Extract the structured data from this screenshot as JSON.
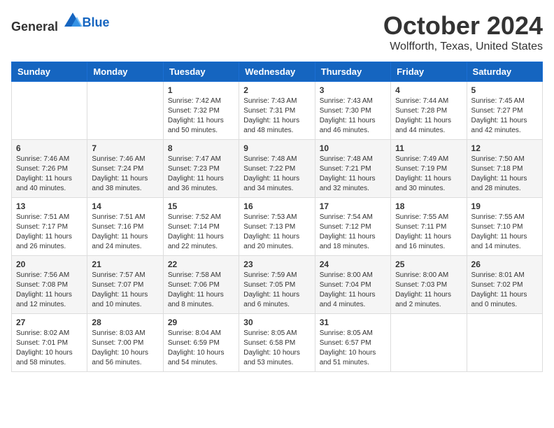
{
  "header": {
    "logo_general": "General",
    "logo_blue": "Blue",
    "month": "October 2024",
    "location": "Wolfforth, Texas, United States"
  },
  "weekdays": [
    "Sunday",
    "Monday",
    "Tuesday",
    "Wednesday",
    "Thursday",
    "Friday",
    "Saturday"
  ],
  "weeks": [
    [
      {
        "day": "",
        "info": ""
      },
      {
        "day": "",
        "info": ""
      },
      {
        "day": "1",
        "info": "Sunrise: 7:42 AM\nSunset: 7:32 PM\nDaylight: 11 hours and 50 minutes."
      },
      {
        "day": "2",
        "info": "Sunrise: 7:43 AM\nSunset: 7:31 PM\nDaylight: 11 hours and 48 minutes."
      },
      {
        "day": "3",
        "info": "Sunrise: 7:43 AM\nSunset: 7:30 PM\nDaylight: 11 hours and 46 minutes."
      },
      {
        "day": "4",
        "info": "Sunrise: 7:44 AM\nSunset: 7:28 PM\nDaylight: 11 hours and 44 minutes."
      },
      {
        "day": "5",
        "info": "Sunrise: 7:45 AM\nSunset: 7:27 PM\nDaylight: 11 hours and 42 minutes."
      }
    ],
    [
      {
        "day": "6",
        "info": "Sunrise: 7:46 AM\nSunset: 7:26 PM\nDaylight: 11 hours and 40 minutes."
      },
      {
        "day": "7",
        "info": "Sunrise: 7:46 AM\nSunset: 7:24 PM\nDaylight: 11 hours and 38 minutes."
      },
      {
        "day": "8",
        "info": "Sunrise: 7:47 AM\nSunset: 7:23 PM\nDaylight: 11 hours and 36 minutes."
      },
      {
        "day": "9",
        "info": "Sunrise: 7:48 AM\nSunset: 7:22 PM\nDaylight: 11 hours and 34 minutes."
      },
      {
        "day": "10",
        "info": "Sunrise: 7:48 AM\nSunset: 7:21 PM\nDaylight: 11 hours and 32 minutes."
      },
      {
        "day": "11",
        "info": "Sunrise: 7:49 AM\nSunset: 7:19 PM\nDaylight: 11 hours and 30 minutes."
      },
      {
        "day": "12",
        "info": "Sunrise: 7:50 AM\nSunset: 7:18 PM\nDaylight: 11 hours and 28 minutes."
      }
    ],
    [
      {
        "day": "13",
        "info": "Sunrise: 7:51 AM\nSunset: 7:17 PM\nDaylight: 11 hours and 26 minutes."
      },
      {
        "day": "14",
        "info": "Sunrise: 7:51 AM\nSunset: 7:16 PM\nDaylight: 11 hours and 24 minutes."
      },
      {
        "day": "15",
        "info": "Sunrise: 7:52 AM\nSunset: 7:14 PM\nDaylight: 11 hours and 22 minutes."
      },
      {
        "day": "16",
        "info": "Sunrise: 7:53 AM\nSunset: 7:13 PM\nDaylight: 11 hours and 20 minutes."
      },
      {
        "day": "17",
        "info": "Sunrise: 7:54 AM\nSunset: 7:12 PM\nDaylight: 11 hours and 18 minutes."
      },
      {
        "day": "18",
        "info": "Sunrise: 7:55 AM\nSunset: 7:11 PM\nDaylight: 11 hours and 16 minutes."
      },
      {
        "day": "19",
        "info": "Sunrise: 7:55 AM\nSunset: 7:10 PM\nDaylight: 11 hours and 14 minutes."
      }
    ],
    [
      {
        "day": "20",
        "info": "Sunrise: 7:56 AM\nSunset: 7:08 PM\nDaylight: 11 hours and 12 minutes."
      },
      {
        "day": "21",
        "info": "Sunrise: 7:57 AM\nSunset: 7:07 PM\nDaylight: 11 hours and 10 minutes."
      },
      {
        "day": "22",
        "info": "Sunrise: 7:58 AM\nSunset: 7:06 PM\nDaylight: 11 hours and 8 minutes."
      },
      {
        "day": "23",
        "info": "Sunrise: 7:59 AM\nSunset: 7:05 PM\nDaylight: 11 hours and 6 minutes."
      },
      {
        "day": "24",
        "info": "Sunrise: 8:00 AM\nSunset: 7:04 PM\nDaylight: 11 hours and 4 minutes."
      },
      {
        "day": "25",
        "info": "Sunrise: 8:00 AM\nSunset: 7:03 PM\nDaylight: 11 hours and 2 minutes."
      },
      {
        "day": "26",
        "info": "Sunrise: 8:01 AM\nSunset: 7:02 PM\nDaylight: 11 hours and 0 minutes."
      }
    ],
    [
      {
        "day": "27",
        "info": "Sunrise: 8:02 AM\nSunset: 7:01 PM\nDaylight: 10 hours and 58 minutes."
      },
      {
        "day": "28",
        "info": "Sunrise: 8:03 AM\nSunset: 7:00 PM\nDaylight: 10 hours and 56 minutes."
      },
      {
        "day": "29",
        "info": "Sunrise: 8:04 AM\nSunset: 6:59 PM\nDaylight: 10 hours and 54 minutes."
      },
      {
        "day": "30",
        "info": "Sunrise: 8:05 AM\nSunset: 6:58 PM\nDaylight: 10 hours and 53 minutes."
      },
      {
        "day": "31",
        "info": "Sunrise: 8:05 AM\nSunset: 6:57 PM\nDaylight: 10 hours and 51 minutes."
      },
      {
        "day": "",
        "info": ""
      },
      {
        "day": "",
        "info": ""
      }
    ]
  ]
}
